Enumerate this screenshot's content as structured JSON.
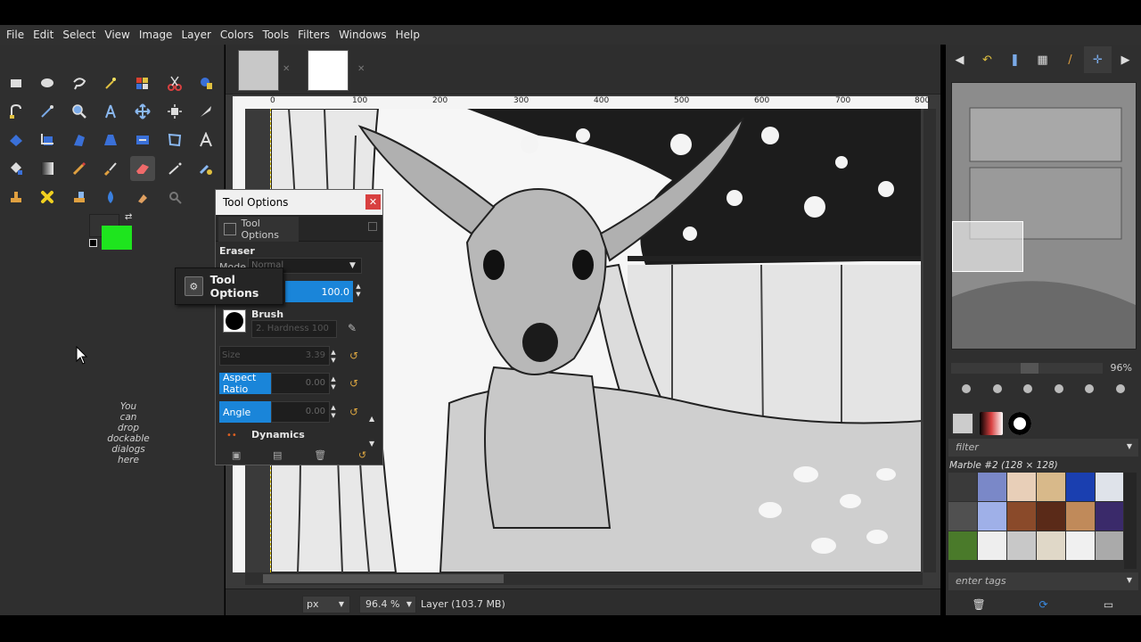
{
  "menu": [
    "File",
    "Edit",
    "Select",
    "View",
    "Image",
    "Layer",
    "Colors",
    "Tools",
    "Filters",
    "Windows",
    "Help"
  ],
  "toolbox": {
    "drop_hint": "You\ncan\ndrop\ndockable\ndialogs\nhere",
    "fg_color": "#1ee51e",
    "bg_color": "#333333"
  },
  "tooltip": {
    "label": "Tool Options"
  },
  "tool_options": {
    "title": "Tool Options",
    "tab_label": "Tool Options",
    "tool_name": "Eraser",
    "mode_label": "Mode",
    "mode_value": "Normal",
    "opacity_value": "100.0",
    "brush_label": "Brush",
    "brush_name": "2. Hardness 100",
    "size_label": "Size",
    "size_value": "3.39",
    "aspect_label": "Aspect Ratio",
    "aspect_value": "0.00",
    "angle_label": "Angle",
    "angle_value": "0.00",
    "dynamics_label": "Dynamics",
    "close_glyph": "✕"
  },
  "canvas": {
    "ruler_ticks": [
      "0",
      "100",
      "200",
      "300",
      "400",
      "500",
      "600",
      "700",
      "800"
    ],
    "unit": "px",
    "zoom": "96.4 %",
    "status": "Layer (103.7 MB)"
  },
  "dock": {
    "nav_zoom": "96%",
    "filter_placeholder": "filter",
    "pattern_name": "Marble #2 (128 × 128)",
    "tags_placeholder": "enter tags",
    "pattern_colors": [
      "#3a3a3a",
      "#7a88c8",
      "#e8cfb8",
      "#d8b98a",
      "#1a3fb0",
      "#dfe3ea",
      "#505050",
      "#9fb0e8",
      "#8a4a2a",
      "#5a2a18",
      "#c08a5a",
      "#3a2a6a",
      "#4a7a2a",
      "#eeeeee",
      "#c8c8c8",
      "#e0d8c8",
      "#f0f0f0",
      "#aaaaaa"
    ]
  }
}
